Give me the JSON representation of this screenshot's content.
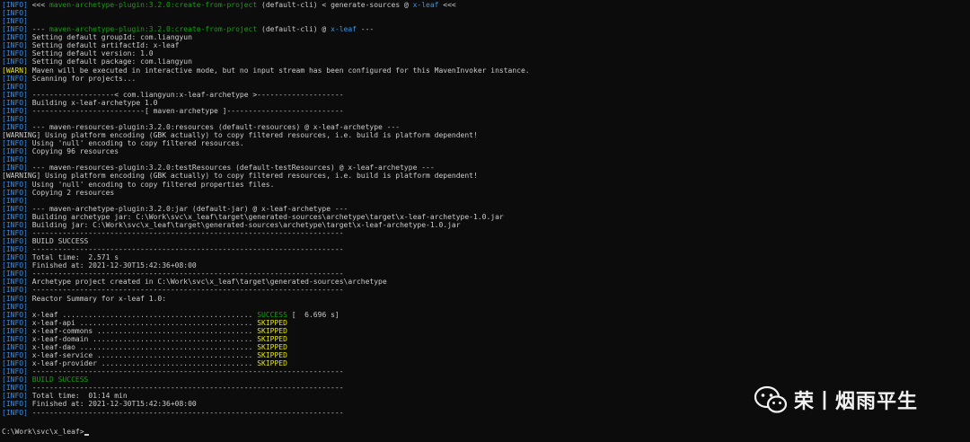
{
  "colors": {
    "background": "#0c0c0c",
    "info": "#3b8eea",
    "text": "#cccccc",
    "success": "#13a10e",
    "warn": "#e5e510"
  },
  "lines": [
    {
      "lvl": "INFO",
      "segs": [
        {
          "t": " <<< "
        },
        {
          "t": "maven-archetype-plugin:3.2.0:create-from-project",
          "c": "green"
        },
        {
          "t": " (default-cli) < generate-sources @ "
        },
        {
          "t": "x-leaf",
          "c": "cyan"
        },
        {
          "t": " <<<"
        }
      ]
    },
    {
      "lvl": "INFO",
      "segs": []
    },
    {
      "lvl": "INFO",
      "segs": []
    },
    {
      "lvl": "INFO",
      "segs": [
        {
          "t": " --- "
        },
        {
          "t": "maven-archetype-plugin:3.2.0:create-from-project",
          "c": "green"
        },
        {
          "t": " (default-cli) @ "
        },
        {
          "t": "x-leaf",
          "c": "cyan"
        },
        {
          "t": " ---"
        }
      ]
    },
    {
      "lvl": "INFO",
      "segs": [
        {
          "t": " Setting default groupId: com.liangyun"
        }
      ]
    },
    {
      "lvl": "INFO",
      "segs": [
        {
          "t": " Setting default artifactId: x-leaf"
        }
      ]
    },
    {
      "lvl": "INFO",
      "segs": [
        {
          "t": " Setting default version: 1.0"
        }
      ]
    },
    {
      "lvl": "INFO",
      "segs": [
        {
          "t": " Setting default package: com.liangyun"
        }
      ]
    },
    {
      "lvl": "WARN",
      "segs": [
        {
          "t": " Maven will be executed in interactive mode, but no input stream has been configured for this MavenInvoker instance."
        }
      ]
    },
    {
      "lvl": "INFO",
      "segs": [
        {
          "t": " Scanning for projects..."
        }
      ]
    },
    {
      "lvl": "INFO",
      "segs": []
    },
    {
      "lvl": "INFO",
      "segs": [
        {
          "t": " -------------------< com.liangyun:x-leaf-archetype >--------------------"
        }
      ]
    },
    {
      "lvl": "INFO",
      "segs": [
        {
          "t": " Building x-leaf-archetype 1.0"
        }
      ]
    },
    {
      "lvl": "INFO",
      "segs": [
        {
          "t": " --------------------------[ maven-archetype ]---------------------------"
        }
      ]
    },
    {
      "lvl": "INFO",
      "segs": []
    },
    {
      "lvl": "INFO",
      "segs": [
        {
          "t": " --- maven-resources-plugin:3.2.0:resources (default-resources) @ x-leaf-archetype ---"
        }
      ]
    },
    {
      "lvl": "WARNING",
      "segs": [
        {
          "t": " Using platform encoding (GBK actually) to copy filtered resources, i.e. build is platform dependent!"
        }
      ]
    },
    {
      "lvl": "INFO",
      "segs": [
        {
          "t": " Using 'null' encoding to copy filtered resources."
        }
      ]
    },
    {
      "lvl": "INFO",
      "segs": [
        {
          "t": " Copying 96 resources"
        }
      ]
    },
    {
      "lvl": "INFO",
      "segs": []
    },
    {
      "lvl": "INFO",
      "segs": [
        {
          "t": " --- maven-resources-plugin:3.2.0:testResources (default-testResources) @ x-leaf-archetype ---"
        }
      ]
    },
    {
      "lvl": "WARNING",
      "segs": [
        {
          "t": " Using platform encoding (GBK actually) to copy filtered resources, i.e. build is platform dependent!"
        }
      ]
    },
    {
      "lvl": "INFO",
      "segs": [
        {
          "t": " Using 'null' encoding to copy filtered properties files."
        }
      ]
    },
    {
      "lvl": "INFO",
      "segs": [
        {
          "t": " Copying 2 resources"
        }
      ]
    },
    {
      "lvl": "INFO",
      "segs": []
    },
    {
      "lvl": "INFO",
      "segs": [
        {
          "t": " --- maven-archetype-plugin:3.2.0:jar (default-jar) @ x-leaf-archetype ---"
        }
      ]
    },
    {
      "lvl": "INFO",
      "segs": [
        {
          "t": " Building archetype jar: C:\\Work\\svc\\x_leaf\\target\\generated-sources\\archetype\\target\\x-leaf-archetype-1.0.jar"
        }
      ]
    },
    {
      "lvl": "INFO",
      "segs": [
        {
          "t": " Building jar: C:\\Work\\svc\\x_leaf\\target\\generated-sources\\archetype\\target\\x-leaf-archetype-1.0.jar"
        }
      ]
    },
    {
      "lvl": "INFO",
      "segs": [
        {
          "t": " ------------------------------------------------------------------------"
        }
      ]
    },
    {
      "lvl": "INFO",
      "segs": [
        {
          "t": " BUILD SUCCESS"
        }
      ]
    },
    {
      "lvl": "INFO",
      "segs": [
        {
          "t": " ------------------------------------------------------------------------"
        }
      ]
    },
    {
      "lvl": "INFO",
      "segs": [
        {
          "t": " Total time:  2.571 s"
        }
      ]
    },
    {
      "lvl": "INFO",
      "segs": [
        {
          "t": " Finished at: 2021-12-30T15:42:36+08:00"
        }
      ]
    },
    {
      "lvl": "INFO",
      "segs": [
        {
          "t": " ------------------------------------------------------------------------"
        }
      ]
    },
    {
      "lvl": "INFO",
      "segs": [
        {
          "t": " Archetype project created in C:\\Work\\svc\\x_leaf\\target\\generated-sources\\archetype"
        }
      ]
    },
    {
      "lvl": "INFO",
      "segs": [
        {
          "t": " ------------------------------------------------------------------------"
        }
      ]
    },
    {
      "lvl": "INFO",
      "segs": [
        {
          "t": " Reactor Summary for x-leaf 1.0:"
        }
      ]
    },
    {
      "lvl": "INFO",
      "segs": []
    },
    {
      "lvl": "INFO",
      "segs": [
        {
          "t": " x-leaf ............................................ "
        },
        {
          "t": "SUCCESS",
          "c": "green"
        },
        {
          "t": " [  6.696 s]"
        }
      ]
    },
    {
      "lvl": "INFO",
      "segs": [
        {
          "t": " x-leaf-api ........................................ "
        },
        {
          "t": "SKIPPED",
          "c": "yellow"
        }
      ]
    },
    {
      "lvl": "INFO",
      "segs": [
        {
          "t": " x-leaf-commons .................................... "
        },
        {
          "t": "SKIPPED",
          "c": "yellow"
        }
      ]
    },
    {
      "lvl": "INFO",
      "segs": [
        {
          "t": " x-leaf-domain ..................................... "
        },
        {
          "t": "SKIPPED",
          "c": "yellow"
        }
      ]
    },
    {
      "lvl": "INFO",
      "segs": [
        {
          "t": " x-leaf-dao ........................................ "
        },
        {
          "t": "SKIPPED",
          "c": "yellow"
        }
      ]
    },
    {
      "lvl": "INFO",
      "segs": [
        {
          "t": " x-leaf-service .................................... "
        },
        {
          "t": "SKIPPED",
          "c": "yellow"
        }
      ]
    },
    {
      "lvl": "INFO",
      "segs": [
        {
          "t": " x-leaf-provider ................................... "
        },
        {
          "t": "SKIPPED",
          "c": "yellow"
        }
      ]
    },
    {
      "lvl": "INFO",
      "segs": [
        {
          "t": " ------------------------------------------------------------------------"
        }
      ]
    },
    {
      "lvl": "INFO",
      "segs": [
        {
          "t": " BUILD SUCCESS",
          "c": "green"
        }
      ]
    },
    {
      "lvl": "INFO",
      "segs": [
        {
          "t": " ------------------------------------------------------------------------"
        }
      ]
    },
    {
      "lvl": "INFO",
      "segs": [
        {
          "t": " Total time:  01:14 min"
        }
      ]
    },
    {
      "lvl": "INFO",
      "segs": [
        {
          "t": " Finished at: 2021-12-30T15:42:36+08:00"
        }
      ]
    },
    {
      "lvl": "INFO",
      "segs": [
        {
          "t": " ------------------------------------------------------------------------"
        }
      ]
    }
  ],
  "prompt": "C:\\Work\\svc\\x_leaf>",
  "watermark": {
    "icon": "wechat-icon",
    "text": "荣丨烟雨平生"
  }
}
